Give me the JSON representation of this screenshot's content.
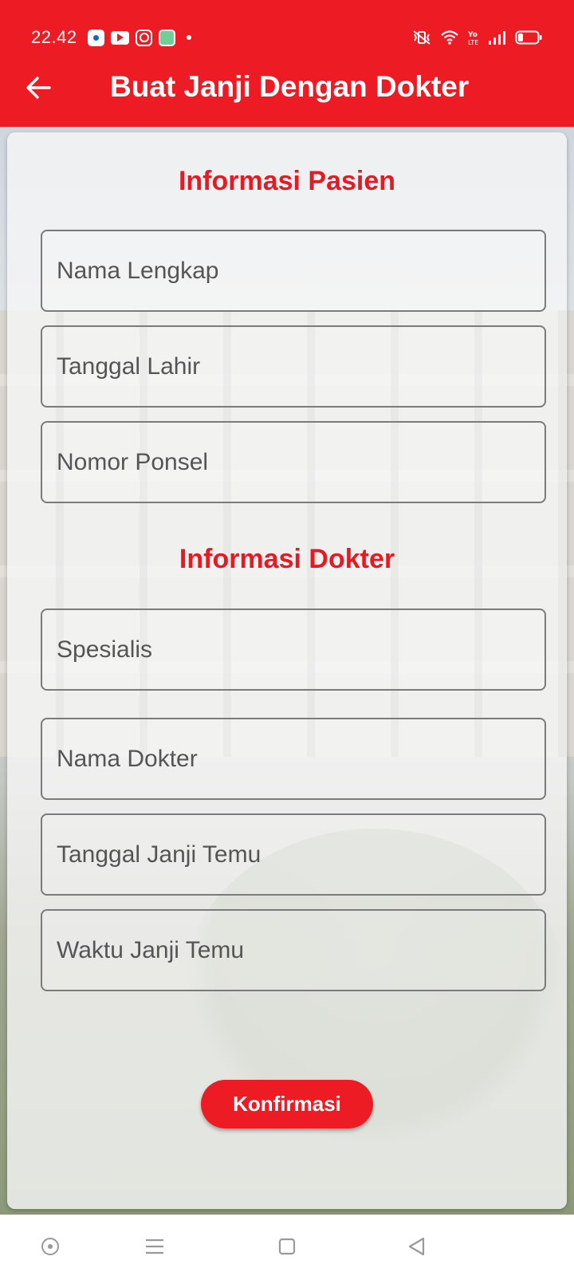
{
  "status_bar": {
    "time": "22.42",
    "notification_icons": [
      "browser-icon",
      "youtube-icon",
      "instagram-icon",
      "app-icon",
      "dot-icon"
    ],
    "system_icons": [
      "vibrate-icon",
      "wifi-icon",
      "volte-icon",
      "signal-icon",
      "battery-icon"
    ]
  },
  "app_bar": {
    "title": "Buat Janji Dengan Dokter",
    "back_icon": "arrow-left-icon",
    "background_color": "#ed1c24"
  },
  "form": {
    "patient_section_title": "Informasi Pasien",
    "patient_fields": {
      "full_name": {
        "placeholder": "Nama Lengkap",
        "value": ""
      },
      "birth_date": {
        "placeholder": "Tanggal Lahir",
        "value": ""
      },
      "phone": {
        "placeholder": "Nomor Ponsel",
        "value": ""
      }
    },
    "doctor_section_title": "Informasi Dokter",
    "doctor_fields": {
      "specialist": {
        "placeholder": "Spesialis",
        "value": ""
      },
      "doctor_name": {
        "placeholder": "Nama Dokter",
        "value": ""
      },
      "appointment_date": {
        "placeholder": "Tanggal Janji Temu",
        "value": ""
      },
      "appointment_time": {
        "placeholder": "Waktu Janji Temu",
        "value": ""
      }
    },
    "confirm_label": "Konfirmasi",
    "accent_color": "#e41b23"
  },
  "nav_bar": {
    "icons": [
      "assistant-icon",
      "recents-icon",
      "home-icon",
      "back-icon"
    ]
  }
}
